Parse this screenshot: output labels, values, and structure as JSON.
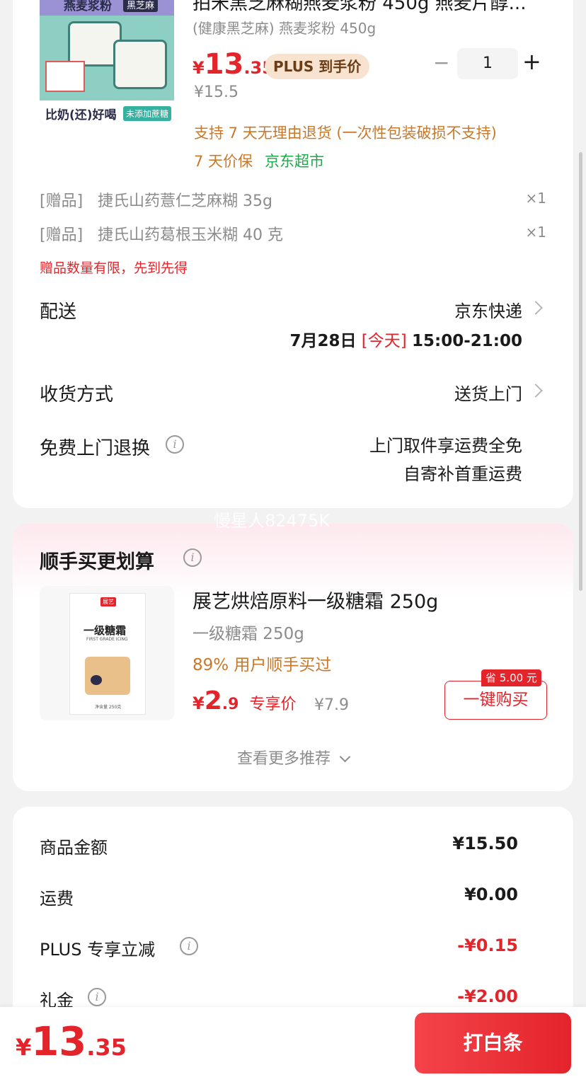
{
  "product": {
    "title": "拍米黑芝麻糊燕麦浆粉 450g 燕麦片醇...",
    "spec": "(健康黑芝麻) 燕麦浆粉 450g",
    "price_int": "13",
    "price_dec": ".35",
    "currency": "¥",
    "plus_badge": "PLUS 到手价",
    "original_price": "¥15.5",
    "quantity": "1",
    "minus": "−",
    "plus": "+",
    "return_policy": "支持 7 天无理由退货 (一次性包装破损不支持)",
    "price_protect": "7 天价保",
    "store": "京东超市",
    "image": {
      "box_top": "燕麦浆粉",
      "box_tag": "黑芝麻",
      "slogan": "比奶(还)好喝",
      "slogan_tag": "未添加蔗糖"
    }
  },
  "gifts": [
    {
      "tag": "[赠品]",
      "name": "捷氏山药薏仁芝麻糊 35g",
      "qty": "×1"
    },
    {
      "tag": "[赠品]",
      "name": "捷氏山药葛根玉米糊 40 克",
      "qty": "×1"
    }
  ],
  "gift_notice": "赠品数量有限，先到先得",
  "delivery": {
    "label": "配送",
    "carrier": "京东快递",
    "date": "7月28日",
    "today": "[今天]",
    "time": "15:00-21:00"
  },
  "receive": {
    "label": "收货方式",
    "value": "送货上门"
  },
  "free_return": {
    "label": "免费上门退换",
    "line1": "上门取件享运费全免",
    "line2": "自寄补首重运费"
  },
  "watermark": "慢星人82475K",
  "recommend": {
    "title": "顺手买更划算",
    "name": "展艺烘焙原料一级糖霜 250g",
    "spec": "一级糖霜 250g",
    "stat": "89% 用户顺手买过",
    "price_int": "2",
    "price_dec": ".9",
    "currency": "¥",
    "price_label": "专享价",
    "original": "¥7.9",
    "save_badge": "省 5.00 元",
    "buy_button": "一键购买",
    "more": "查看更多推荐",
    "image": {
      "brand": "展艺",
      "title": "一级糖霜",
      "subtitle": "FIRST GRADE ICING",
      "net": "净含量 250克"
    }
  },
  "summary": [
    {
      "label": "商品金额",
      "value": "¥15.50",
      "info": false,
      "negative": false
    },
    {
      "label": "运费",
      "value": "¥0.00",
      "info": false,
      "negative": false
    },
    {
      "label": "PLUS 专享立减",
      "value": "-¥0.15",
      "info": true,
      "negative": true
    },
    {
      "label": "礼金",
      "value": "-¥2.00",
      "info": true,
      "negative": true
    }
  ],
  "footer": {
    "currency": "¥",
    "total_int": "13",
    "total_dec": ".35",
    "button": "打白条"
  },
  "colors": {
    "accent_red": "#e4242b",
    "orange": "#c9782a",
    "green": "#20a84a",
    "plus_badge_bg": "#f7e3cf",
    "plus_badge_text": "#6b3c16"
  }
}
